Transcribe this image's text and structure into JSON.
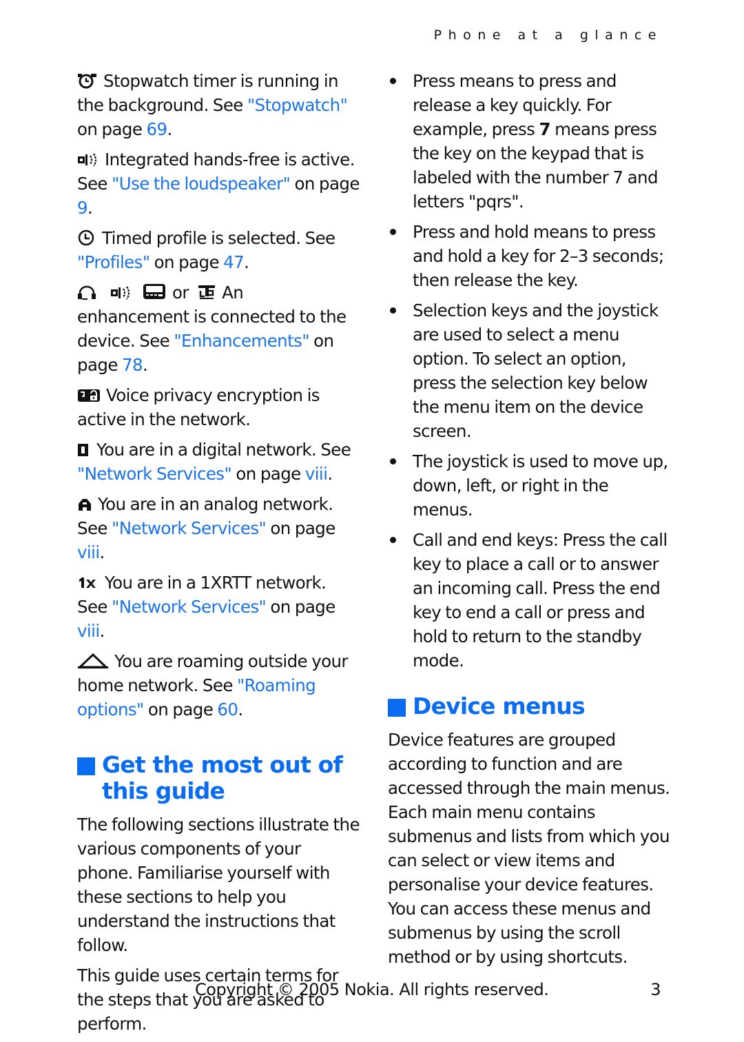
{
  "running_head": "Phone at a glance",
  "left_column": {
    "indicators": [
      {
        "icon": "stopwatch-icon",
        "text_before": "Stopwatch timer is running in the background. See ",
        "link": "\"Stopwatch\"",
        "text_mid": " on page ",
        "page": "69",
        "text_after": "."
      },
      {
        "icon": "loudspeaker-icon",
        "text_before": "Integrated hands-free is active. See ",
        "link": "\"Use the loudspeaker\"",
        "text_mid": " on page ",
        "page": "9",
        "text_after": "."
      },
      {
        "icon": "timed-profile-icon",
        "text_before": "Timed profile is selected. See ",
        "link": "\"Profiles\"",
        "text_mid": " on page ",
        "page": "47",
        "text_after": "."
      },
      {
        "icons": [
          "headset-icon",
          "loudspeaker-icon",
          "car-kit-icon",
          "tty-icon"
        ],
        "or_label": "or",
        "text_before": "An enhancement is connected to the device. See ",
        "link": "\"Enhancements\"",
        "text_mid": " on page ",
        "page": "78",
        "text_after": "."
      },
      {
        "icon": "voice-privacy-icon",
        "text_before": "Voice privacy encryption is active in the network."
      },
      {
        "icon": "digital-network-icon",
        "text_before": "You are in a digital network. See ",
        "link": "\"Network Services\"",
        "text_mid": " on page ",
        "page": "viii",
        "text_after": "."
      },
      {
        "icon": "analog-network-icon",
        "text_before": "You are in an analog network. See ",
        "link": "\"Network Services\"",
        "text_mid": " on page ",
        "page": "viii",
        "text_after": "."
      },
      {
        "icon": "1x-network-icon",
        "text_before": "You are in a 1XRTT network. See ",
        "link": "\"Network Services\"",
        "text_mid": " on page ",
        "page": "viii",
        "text_after": "."
      },
      {
        "icon": "roaming-icon",
        "text_before": "You are roaming outside your home network. See ",
        "link": "\"Roaming options\"",
        "text_mid": " on page ",
        "page": "60",
        "text_after": "."
      }
    ],
    "section": {
      "heading": "Get the most out of this guide",
      "paragraphs": [
        "The following sections illustrate the various components of your phone. Familiarise yourself with these sections to help you understand the instructions that follow.",
        "This guide uses certain terms for the steps that you are asked to perform."
      ]
    }
  },
  "right_column": {
    "bullets": [
      {
        "parts": [
          "Press means to press and release a key quickly. For example, press ",
          "7",
          " means press the key on the keypad that is labeled with the number 7 and letters \"pqrs\"."
        ]
      },
      {
        "parts": [
          "Press and hold means to press and hold a key for 2–3 seconds; then release the key."
        ]
      },
      {
        "parts": [
          "Selection keys and the joystick are used to select a menu option. To select an option, press the selection key below the menu item on the device screen."
        ]
      },
      {
        "parts": [
          "The joystick is used to move up, down, left, or right in the menus."
        ]
      },
      {
        "parts": [
          "Call and end keys: Press the call key to place a call or to answer an incoming call. Press the end key to end a call or press and hold to return to the standby mode."
        ]
      }
    ],
    "section": {
      "heading": "Device menus",
      "paragraph": "Device features are grouped according to function and are accessed through the main menus. Each main menu contains submenus and lists from which you can select or view items and personalise your device features. You can access these menus and submenus by using the scroll method or by using shortcuts."
    }
  },
  "footer": {
    "copyright": "Copyright © 2005 Nokia. All rights reserved.",
    "page_number": "3"
  },
  "colors": {
    "accent": "#0a6cf0",
    "link": "#1a73e8",
    "text": "#111111"
  }
}
